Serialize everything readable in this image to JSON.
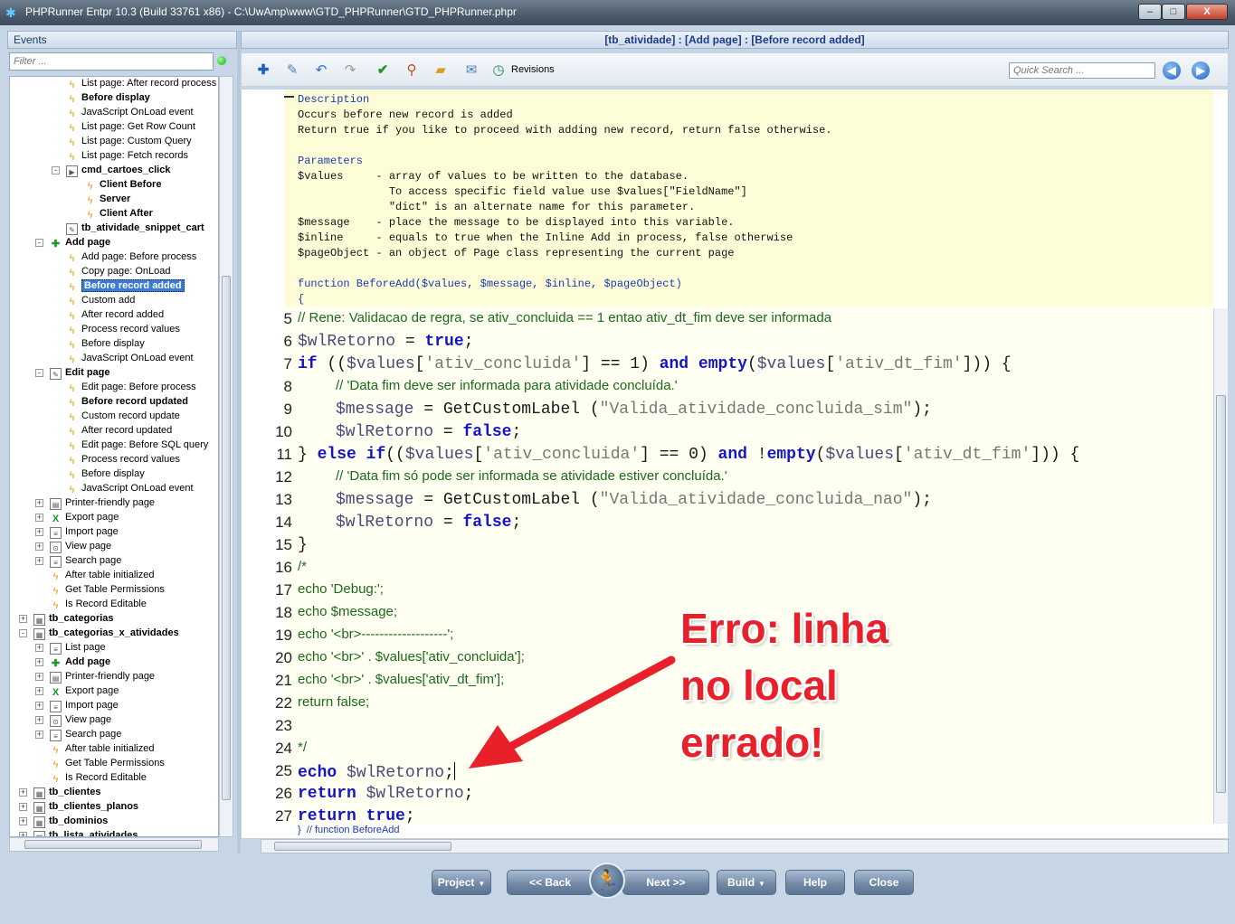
{
  "window": {
    "title": "PHPRunner Entpr 10.3 (Build 33761 x86) - C:\\UwAmp\\www\\GTD_PHPRunner\\GTD_PHPRunner.phpr",
    "minimize": "–",
    "maximize": "□",
    "close": "X"
  },
  "left_pane": {
    "header": "Events",
    "filter_placeholder": "Filter ...",
    "tree": [
      {
        "label": "List page: After record process",
        "icon": "bolt-icon",
        "bold": false
      },
      {
        "label": "Before display",
        "icon": "bolt-icon",
        "bold": true
      },
      {
        "label": "JavaScript OnLoad event",
        "icon": "bolt-icon",
        "bold": false
      },
      {
        "label": "List page: Get Row Count",
        "icon": "bolt-icon",
        "bold": false
      },
      {
        "label": "List page: Custom Query",
        "icon": "bolt-icon",
        "bold": false
      },
      {
        "label": "List page: Fetch records",
        "icon": "bolt-icon",
        "bold": false
      },
      {
        "label": "cmd_cartoes_click",
        "icon": "button-icon",
        "bold": true
      },
      {
        "label": "Client Before",
        "icon": "bolt-icon",
        "bold": true
      },
      {
        "label": "Server",
        "icon": "bolt-icon",
        "bold": true
      },
      {
        "label": "Client After",
        "icon": "bolt-icon",
        "bold": true
      },
      {
        "label": "tb_atividade_snippet_cart",
        "icon": "snippet-icon",
        "bold": true
      },
      {
        "label": "Add page",
        "icon": "add-page-icon",
        "bold": true
      },
      {
        "label": "Add page: Before process",
        "icon": "bolt-icon",
        "bold": false
      },
      {
        "label": "Copy page: OnLoad",
        "icon": "bolt-icon",
        "bold": false
      },
      {
        "label": "Before record added",
        "icon": "bolt-icon",
        "bold": true,
        "selected": true
      },
      {
        "label": "Custom add",
        "icon": "bolt-icon",
        "bold": false
      },
      {
        "label": "After record added",
        "icon": "bolt-icon",
        "bold": false
      },
      {
        "label": "Process record values",
        "icon": "bolt-icon",
        "bold": false
      },
      {
        "label": "Before display",
        "icon": "bolt-icon",
        "bold": false
      },
      {
        "label": "JavaScript OnLoad event",
        "icon": "bolt-icon",
        "bold": false
      },
      {
        "label": "Edit page",
        "icon": "edit-page-icon",
        "bold": true
      },
      {
        "label": "Edit page: Before process",
        "icon": "bolt-icon",
        "bold": false
      },
      {
        "label": "Before record updated",
        "icon": "bolt-icon",
        "bold": true
      },
      {
        "label": "Custom record update",
        "icon": "bolt-icon",
        "bold": false
      },
      {
        "label": "After record updated",
        "icon": "bolt-icon",
        "bold": false
      },
      {
        "label": "Edit page: Before SQL query",
        "icon": "bolt-icon",
        "bold": false
      },
      {
        "label": "Process record values",
        "icon": "bolt-icon",
        "bold": false
      },
      {
        "label": "Before display",
        "icon": "bolt-icon",
        "bold": false
      },
      {
        "label": "JavaScript OnLoad event",
        "icon": "bolt-icon",
        "bold": false
      },
      {
        "label": "Printer-friendly page",
        "icon": "printer-icon",
        "bold": false
      },
      {
        "label": "Export page",
        "icon": "excel-icon",
        "bold": false
      },
      {
        "label": "Import page",
        "icon": "import-icon",
        "bold": false
      },
      {
        "label": "View page",
        "icon": "view-icon",
        "bold": false
      },
      {
        "label": "Search page",
        "icon": "search-page-icon",
        "bold": false
      },
      {
        "label": "After table initialized",
        "icon": "bolt-icon",
        "bold": false
      },
      {
        "label": "Get Table Permissions",
        "icon": "bolt-icon",
        "bold": false
      },
      {
        "label": "Is Record Editable",
        "icon": "bolt-icon",
        "bold": false
      },
      {
        "label": "tb_categorias",
        "icon": "table-icon",
        "bold": true
      },
      {
        "label": "tb_categorias_x_atividades",
        "icon": "table-icon",
        "bold": true
      },
      {
        "label": "List page",
        "icon": "list-page-icon",
        "bold": false
      },
      {
        "label": "Add page",
        "icon": "add-page-icon",
        "bold": true
      },
      {
        "label": "Printer-friendly page",
        "icon": "printer-icon",
        "bold": false
      },
      {
        "label": "Export page",
        "icon": "excel-icon",
        "bold": false
      },
      {
        "label": "Import page",
        "icon": "import-icon",
        "bold": false
      },
      {
        "label": "View page",
        "icon": "view-icon",
        "bold": false
      },
      {
        "label": "Search page",
        "icon": "search-page-icon",
        "bold": false
      },
      {
        "label": "After table initialized",
        "icon": "bolt-icon",
        "bold": false
      },
      {
        "label": "Get Table Permissions",
        "icon": "bolt-icon",
        "bold": false
      },
      {
        "label": "Is Record Editable",
        "icon": "bolt-icon",
        "bold": false
      },
      {
        "label": "tb_clientes",
        "icon": "table-icon",
        "bold": true
      },
      {
        "label": "tb_clientes_planos",
        "icon": "table-icon",
        "bold": true
      },
      {
        "label": "tb_dominios",
        "icon": "table-icon",
        "bold": true
      },
      {
        "label": "tb_lista_atividades",
        "icon": "table-icon",
        "bold": true
      }
    ]
  },
  "right_pane": {
    "header": "[tb_atividade] : [Add page] : [Before record added]",
    "toolbar": {
      "revisions_label": "Revisions",
      "quick_search_placeholder": "Quick Search ..."
    },
    "description": [
      "Description",
      "Occurs before new record is added",
      "Return true if you like to proceed with adding new record, return false otherwise.",
      "",
      "Parameters",
      "$values     - array of values to be written to the database.",
      "              To access specific field value use $values[\"FieldName\"]",
      "              \"dict\" is an alternate name for this parameter.",
      "$message    - place the message to be displayed into this variable.",
      "$inline     - equals to true when the Inline Add in process, false otherwise",
      "$pageObject - an object of Page class representing the current page",
      "",
      "function BeforeAdd($values, $message, $inline, $pageObject)",
      "{"
    ],
    "code_lines": [
      {
        "num": "5",
        "text": "// Rene: Validacao de regra, se ativ_concluida == 1 entao ativ_dt_fim deve ser informada"
      },
      {
        "num": "6",
        "text": "$wlRetorno = true;"
      },
      {
        "num": "7",
        "text": "if (($values['ativ_concluida'] == 1) and empty($values['ativ_dt_fim'])) {"
      },
      {
        "num": "8",
        "text": "// 'Data fim deve ser informada para atividade concluída.'"
      },
      {
        "num": "9",
        "text": "$message = GetCustomLabel (\"Valida_atividade_concluida_sim\");"
      },
      {
        "num": "10",
        "text": "$wlRetorno = false;"
      },
      {
        "num": "11",
        "text": "} else if(($values['ativ_concluida'] == 0) and !empty($values['ativ_dt_fim'])) {"
      },
      {
        "num": "12",
        "text": "// 'Data fim só pode ser informada se atividade estiver concluída.'"
      },
      {
        "num": "13",
        "text": "$message = GetCustomLabel (\"Valida_atividade_concluida_nao\");"
      },
      {
        "num": "14",
        "text": "$wlRetorno = false;"
      },
      {
        "num": "15",
        "text": "}"
      },
      {
        "num": "16",
        "text": "/*"
      },
      {
        "num": "17",
        "text": "echo 'Debug:';"
      },
      {
        "num": "18",
        "text": "echo $message;"
      },
      {
        "num": "19",
        "text": "echo '<br>-------------------';"
      },
      {
        "num": "20",
        "text": "echo '<br>' . $values['ativ_concluida'];"
      },
      {
        "num": "21",
        "text": "echo '<br>' . $values['ativ_dt_fim'];"
      },
      {
        "num": "22",
        "text": "return false;"
      },
      {
        "num": "23",
        "text": ""
      },
      {
        "num": "24",
        "text": "*/"
      },
      {
        "num": "25",
        "text": "echo $wlRetorno;"
      },
      {
        "num": "26",
        "text": "return $wlRetorno;"
      },
      {
        "num": "27",
        "text": "return true;"
      }
    ],
    "footer_comment": "}  // function BeforeAdd"
  },
  "annotation": {
    "line1": "Erro: linha",
    "line2": "no local",
    "line3": "errado!",
    "color": "#e8202a"
  },
  "bottom_bar": {
    "project": "Project",
    "back": "<< Back",
    "next": "Next >>",
    "build": "Build",
    "help": "Help",
    "close": "Close"
  },
  "colors": {
    "selection": "#3a7bd5",
    "description_bg": "#fdfdd8",
    "keyword": "#1414c8",
    "comment": "#1a7a1a"
  }
}
